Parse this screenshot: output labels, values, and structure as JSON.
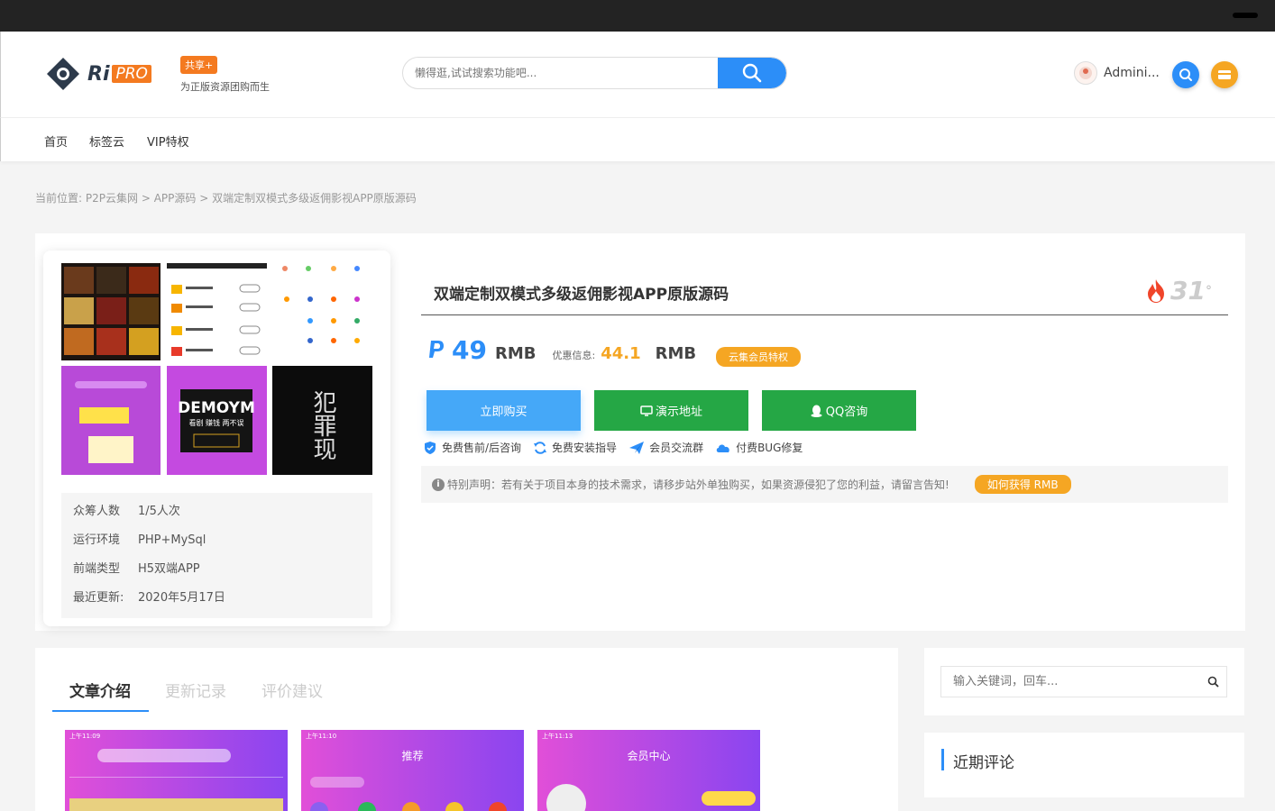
{
  "header": {
    "logo_text": "Ri",
    "logo_pro": "PRO",
    "share_tag": "共享+",
    "share_sub": "为正版资源团购而生",
    "search_placeholder": "懒得逛,试试搜索功能吧...",
    "username": "Admini..."
  },
  "nav": {
    "items": [
      {
        "label": "首页"
      },
      {
        "label": "标签云"
      },
      {
        "label": "VIP特权"
      }
    ]
  },
  "breadcrumb": {
    "prefix": "当前位置:",
    "items": [
      "P2P云集网",
      "APP源码",
      "双端定制双模式多级返佣影视APP原版源码"
    ],
    "separator": ">"
  },
  "product": {
    "title": "双端定制双模式多级返佣影视APP原版源码",
    "views": "31",
    "views_suffix": "°",
    "price": "49",
    "currency": "RMB",
    "discount_label": "优惠信息:",
    "discount_price": "44.1",
    "discount_currency": "RMB",
    "vip_badge": "云集会员特权",
    "buttons": {
      "buy": "立即购买",
      "demo": "演示地址",
      "qq": "QQ咨询"
    },
    "features": [
      {
        "label": "免费售前/后咨询",
        "icon": "shield-icon"
      },
      {
        "label": "免费安装指导",
        "icon": "refresh-icon"
      },
      {
        "label": "会员交流群",
        "icon": "plane-icon"
      },
      {
        "label": "付费BUG修复",
        "icon": "cloud-icon"
      }
    ],
    "notice": "特别声明：若有关于项目本身的技术需求，请移步站外单独购买，如果资源侵犯了您的利益，请留言告知!",
    "notice_button": "如何获得 RMB",
    "meta": [
      {
        "key": "众筹人数",
        "value": "1/5人次"
      },
      {
        "key": "运行环境",
        "value": "PHP+MySql"
      },
      {
        "key": "前端类型",
        "value": "H5双端APP"
      },
      {
        "key": "最近更新:",
        "value": "2020年5月17日"
      }
    ],
    "thumb_demo_text": "DEMOYM",
    "thumb_sub_text": "看剧 赚钱 两不误",
    "thumb_crime_text": "犯罪现"
  },
  "content": {
    "tabs": [
      {
        "label": "文章介绍",
        "active": true
      },
      {
        "label": "更新记录",
        "active": false
      },
      {
        "label": "评价建议",
        "active": false
      }
    ],
    "screens": [
      {
        "time": "上午11:09",
        "title": ""
      },
      {
        "time": "上午11:10",
        "title": "推荐"
      },
      {
        "time": "上午11:13",
        "title": "会员中心"
      }
    ]
  },
  "sidebar": {
    "search_placeholder": "输入关键词，回车...",
    "recent_title": "近期评论"
  },
  "colors": {
    "accent": "#2c8ef8",
    "green": "#25a745",
    "orange": "#f5a623",
    "brand_orange": "#f47a20"
  }
}
